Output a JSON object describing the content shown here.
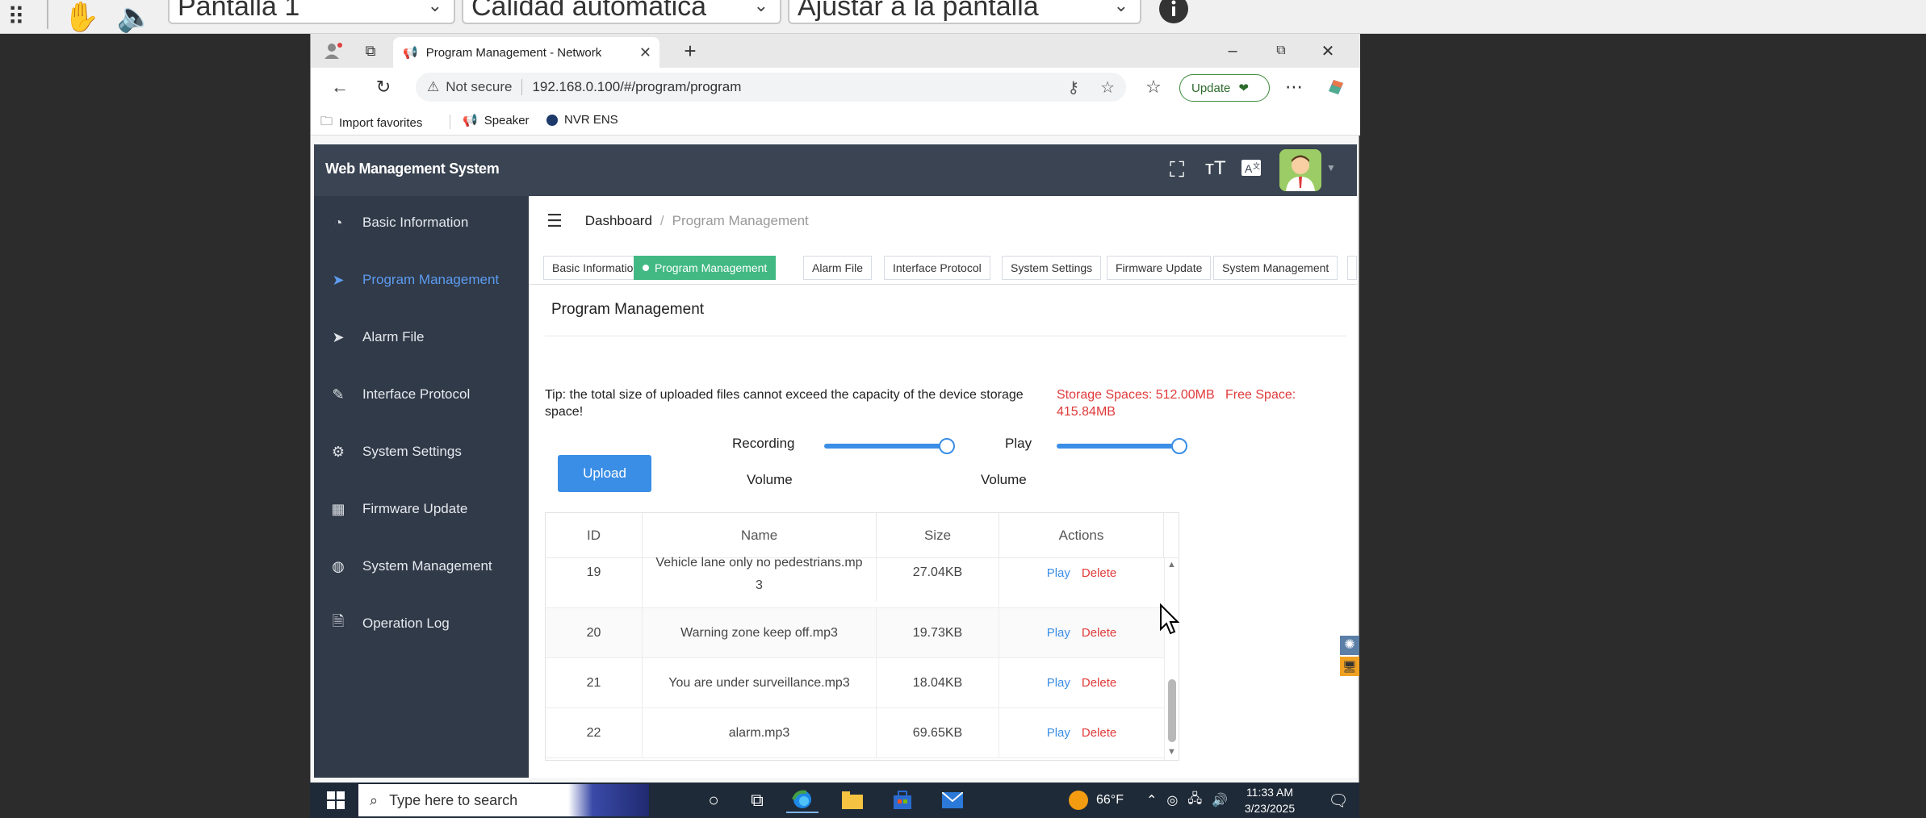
{
  "viewer": {
    "screen_select": "Pantalla 1",
    "quality_select": "Calidad automática",
    "fit_select": "Ajustar a la pantalla"
  },
  "browser": {
    "tab_title": "Program Management - Network",
    "url_warning": "Not secure",
    "url": "192.168.0.100/#/program/program",
    "update_label": "Update",
    "favorites": [
      "Import favorites",
      "Speaker",
      "NVR ENS"
    ]
  },
  "app": {
    "title": "Web Management System",
    "sidebar": [
      {
        "label": "Basic Information",
        "icon": "dashboard-icon",
        "active": false
      },
      {
        "label": "Program Management",
        "icon": "send-icon",
        "active": true
      },
      {
        "label": "Alarm File",
        "icon": "send-icon",
        "active": false
      },
      {
        "label": "Interface Protocol",
        "icon": "document-edit-icon",
        "active": false
      },
      {
        "label": "System Settings",
        "icon": "gear-icon",
        "active": false
      },
      {
        "label": "Firmware Update",
        "icon": "grid-icon",
        "active": false
      },
      {
        "label": "System Management",
        "icon": "globe-icon",
        "active": false
      },
      {
        "label": "Operation Log",
        "icon": "file-icon",
        "active": false
      }
    ],
    "breadcrumb": {
      "home": "Dashboard",
      "separator": "/",
      "current": "Program Management"
    },
    "tags": [
      "Basic Information",
      "Program Management",
      "Alarm File",
      "Interface Protocol",
      "System Settings",
      "Firmware Update",
      "System Management"
    ],
    "panel_title": "Program Management",
    "tip": "Tip: the total size of uploaded files cannot exceed the capacity of the device storage space!",
    "storage": "Storage Spaces: 512.00MB",
    "free_space": "Free Space: 415.84MB",
    "upload_label": "Upload",
    "recording_volume_label_1": "Recording",
    "recording_volume_label_2": "Volume",
    "play_volume_label_1": "Play",
    "play_volume_label_2": "Volume",
    "recording_volume_level": 1.0,
    "play_volume_level": 1.0,
    "table": {
      "headers": [
        "ID",
        "Name",
        "Size",
        "Actions"
      ],
      "rows": [
        {
          "id": "19",
          "name": "Vehicle lane only no pedestrians.mp3",
          "size": "27.04KB"
        },
        {
          "id": "20",
          "name": "Warning zone keep off.mp3",
          "size": "19.73KB"
        },
        {
          "id": "21",
          "name": "You are under surveillance.mp3",
          "size": "18.04KB"
        },
        {
          "id": "22",
          "name": "alarm.mp3",
          "size": "69.65KB"
        }
      ],
      "play_label": "Play",
      "delete_label": "Delete"
    }
  },
  "taskbar": {
    "search_placeholder": "Type here to search",
    "weather": "66°F",
    "time": "11:33 AM",
    "date": "3/23/2025"
  },
  "colors": {
    "sidebar_bg": "#303a48",
    "header_bg": "#3a4452",
    "active_blue": "#5d9bf0",
    "tag_active": "#42b983",
    "primary": "#3a8ee6",
    "danger": "#e03a3a"
  }
}
